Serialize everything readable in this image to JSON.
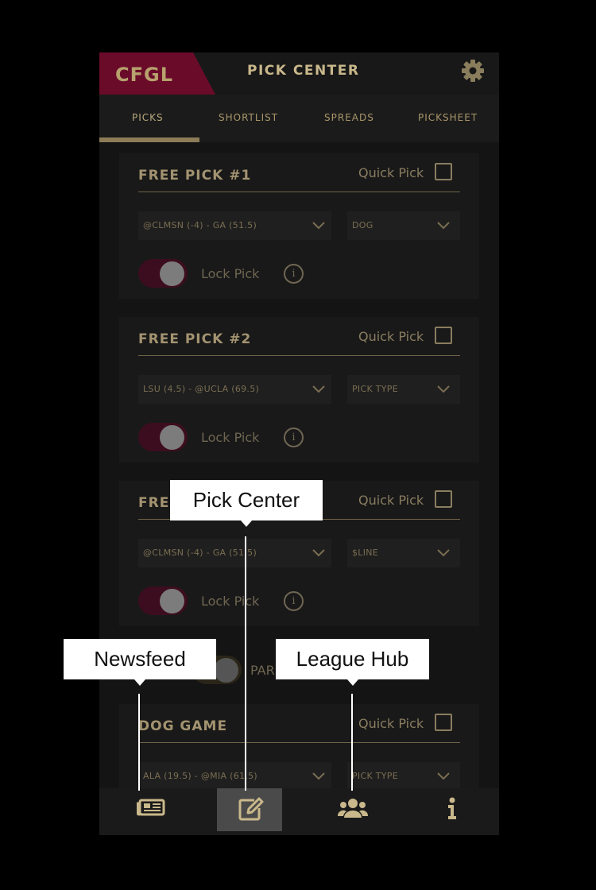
{
  "header": {
    "logo": "CFGL",
    "title": "PICK CENTER"
  },
  "tabs": [
    {
      "label": "PICKS"
    },
    {
      "label": "SHORTLIST"
    },
    {
      "label": "SPREADS"
    },
    {
      "label": "PICKSHEET"
    }
  ],
  "cards": [
    {
      "title": "FREE PICK #1",
      "quick_pick": "Quick Pick",
      "game": "@CLMSN (-4) - GA (51.5)",
      "pick_type": "DOG",
      "lock_label": "Lock Pick"
    },
    {
      "title": "FREE PICK #2",
      "quick_pick": "Quick Pick",
      "game": "LSU (4.5) - @UCLA (69.5)",
      "pick_type": "PICK TYPE",
      "lock_label": "Lock Pick"
    },
    {
      "title": "FREE PICK #3",
      "quick_pick": "Quick Pick",
      "game": "@CLMSN (-4) - GA (51.5)",
      "pick_type": "$LINE",
      "lock_label": "Lock Pick"
    },
    {
      "title": "DOG GAME",
      "quick_pick": "Quick Pick",
      "game": "ALA (19.5) - @MIA (61.5)",
      "pick_type": "PICK TYPE"
    }
  ],
  "parlay": {
    "label": "PARLAY"
  },
  "nav": [
    {
      "icon": "newspaper-icon"
    },
    {
      "icon": "edit-icon"
    },
    {
      "icon": "users-icon"
    },
    {
      "icon": "info-icon"
    }
  ],
  "callouts": {
    "pick_center": "Pick Center",
    "newsfeed": "Newsfeed",
    "league_hub": "League Hub"
  },
  "colors": {
    "accent": "#6a0b2a",
    "gold": "#b7a16d",
    "background": "#141414"
  }
}
